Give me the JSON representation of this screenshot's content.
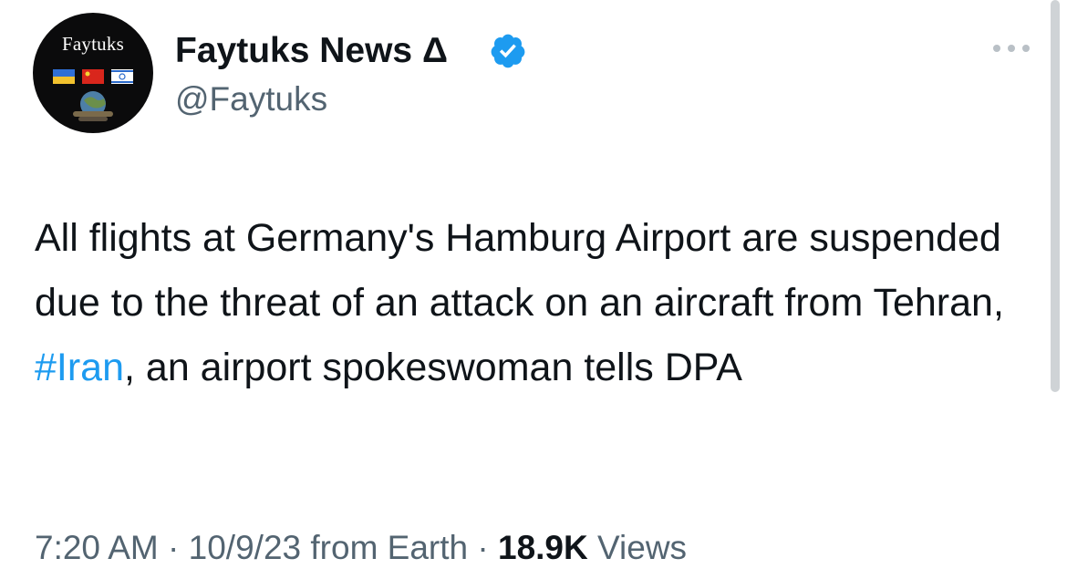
{
  "author": {
    "avatar_logo_text": "Faytuks",
    "display_name": "Faytuks News Δ",
    "handle": "@Faytuks",
    "verified_icon": "verified-badge-icon",
    "more_icon": "more-options-icon"
  },
  "tweet": {
    "text_part1": "All flights at Germany's Hamburg Airport are suspended due to the threat of an attack on an aircraft from Tehran, ",
    "hashtag": "#Iran",
    "text_part2": ", an airport spokeswoman tells DPA"
  },
  "meta": {
    "time": "7:20 AM",
    "separator": " · ",
    "date": "10/9/23",
    "source": " from Earth",
    "views_count": "18.9K",
    "views_label": " Views"
  },
  "colors": {
    "text": "#0f1419",
    "secondary": "#536471",
    "link": "#1d9bf0",
    "verified": "#1d9bf0"
  }
}
